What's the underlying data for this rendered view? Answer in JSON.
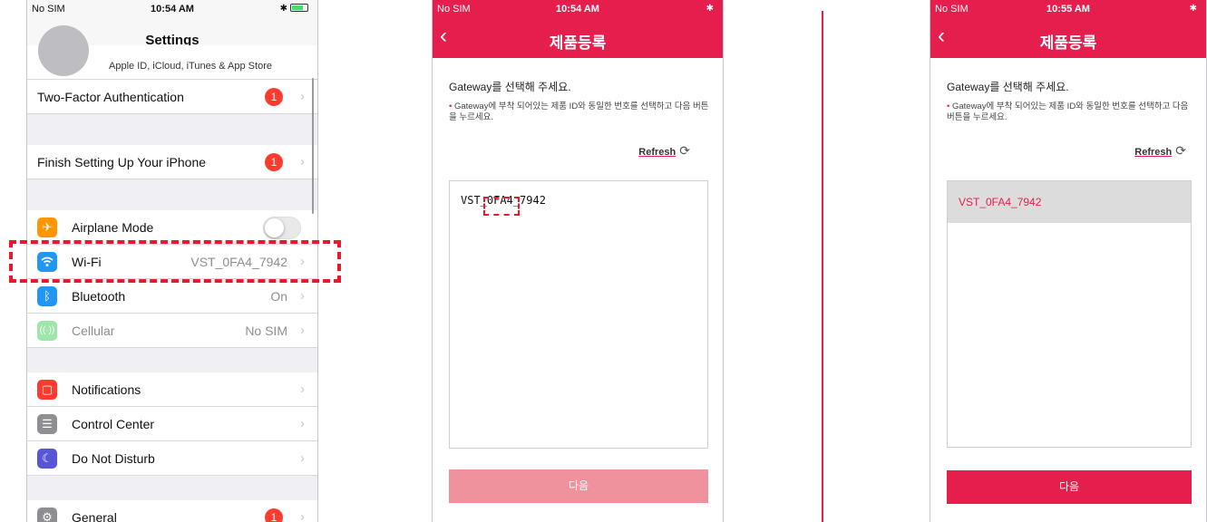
{
  "settings": {
    "status": {
      "carrier": "No SIM",
      "time": "10:54 AM",
      "icons": "✱"
    },
    "title": "Settings",
    "apple_id_sub": "Apple ID, iCloud, iTunes & App Store",
    "rows": [
      {
        "label": "Two-Factor Authentication",
        "badge": "1"
      },
      {
        "label": "Finish Setting Up Your iPhone",
        "badge": "1"
      }
    ],
    "airplane": {
      "label": "Airplane Mode",
      "toggle": "off"
    },
    "wifi": {
      "label": "Wi-Fi",
      "value": "VST_0FA4_7942"
    },
    "bluetooth": {
      "label": "Bluetooth",
      "value": "On"
    },
    "cellular": {
      "label": "Cellular",
      "value": "No SIM"
    },
    "notifications": {
      "label": "Notifications"
    },
    "control_center": {
      "label": "Control Center"
    },
    "dnd": {
      "label": "Do Not Disturb"
    },
    "general": {
      "label": "General",
      "badge": "1"
    }
  },
  "app1": {
    "status": {
      "carrier": "No SIM",
      "time": "10:54 AM",
      "icons": "✱"
    },
    "title": "제품등록",
    "heading": "Gateway를 선택해 주세요.",
    "note": "Gateway에 부착 되어있는 제품 ID와 동일한 번호를 선택하고 다음 버튼을 누르세요.",
    "refresh": "Refresh",
    "entry": "VST_0FA4_7942",
    "next": "다음"
  },
  "app2": {
    "status": {
      "carrier": "No SIM",
      "time": "10:55 AM",
      "icons": "✱"
    },
    "title": "제품등록",
    "heading": "Gateway를 선택해 주세요.",
    "note": "Gateway에 부착 되어있는 제품 ID와 동일한 번호를 선택하고 다음 버튼을 누르세요.",
    "refresh": "Refresh",
    "entry": "VST_0FA4_7942",
    "next": "다음"
  },
  "colors": {
    "accent": "#e61e4d",
    "disabled": "#f0929e",
    "ios_red": "#ff3b30",
    "wifi_blue": "#2196f3",
    "airplane_orange": "#ff9500"
  },
  "icons": [
    "airplane-icon",
    "wifi-icon",
    "bluetooth-icon",
    "cellular-icon",
    "notifications-icon",
    "control-center-icon",
    "moon-icon",
    "gear-icon",
    "refresh-icon",
    "back-chevron-icon"
  ]
}
